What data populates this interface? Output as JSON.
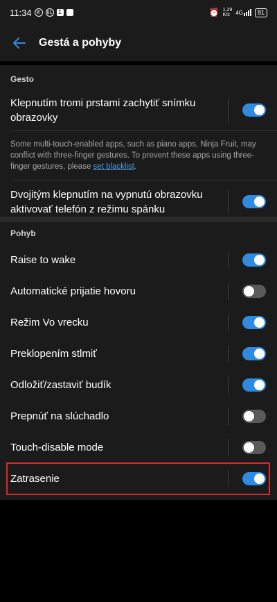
{
  "status_bar": {
    "time": "11:34",
    "icons": [
      "whatsapp-icon",
      "notification-81-icon",
      "sigma-icon",
      "image-icon"
    ],
    "right_icons": [
      "alarm-icon",
      "data-speed-icon",
      "4g-signal-icon"
    ],
    "speed_value": "1.29",
    "speed_unit": "K/s",
    "network": "4G",
    "battery": "81"
  },
  "app_bar": {
    "title": "Gestá a pohyby",
    "back_icon": "arrow-left-icon"
  },
  "gesture_section": {
    "header": "Gesto",
    "three_finger_label": "Klepnutím tromi prstami zachytiť snímku obrazovky",
    "three_finger_on": true,
    "note_text": "Some multi-touch-enabled apps, such as piano apps, Ninja Fruit, may conflict with three-finger gestures. To prevent these apps using three-finger gestures, please ",
    "note_link": "set blacklist",
    "note_end": ".",
    "double_tap_label": "Dvojitým klepnutím na vypnutú obrazovku aktivovať telefón z režimu spánku",
    "double_tap_on": true
  },
  "motion_section": {
    "header": "Pohyb",
    "items": [
      {
        "label": "Raise to wake",
        "on": true
      },
      {
        "label": "Automatické prijatie hovoru",
        "on": false
      },
      {
        "label": "Režim Vo vrecku",
        "on": true
      },
      {
        "label": "Preklopením stlmiť",
        "on": true
      },
      {
        "label": "Odložiť/zastaviť budík",
        "on": true
      },
      {
        "label": "Prepnúť na slúchadlo",
        "on": false
      },
      {
        "label": "Touch-disable mode",
        "on": false
      },
      {
        "label": "Zatrasenie",
        "on": true
      }
    ]
  },
  "colors": {
    "accent": "#2f8ae0",
    "toggle_off": "#5a5a5a",
    "highlight": "#e0262d",
    "background": "#000000",
    "surface": "#1b1b1b"
  }
}
